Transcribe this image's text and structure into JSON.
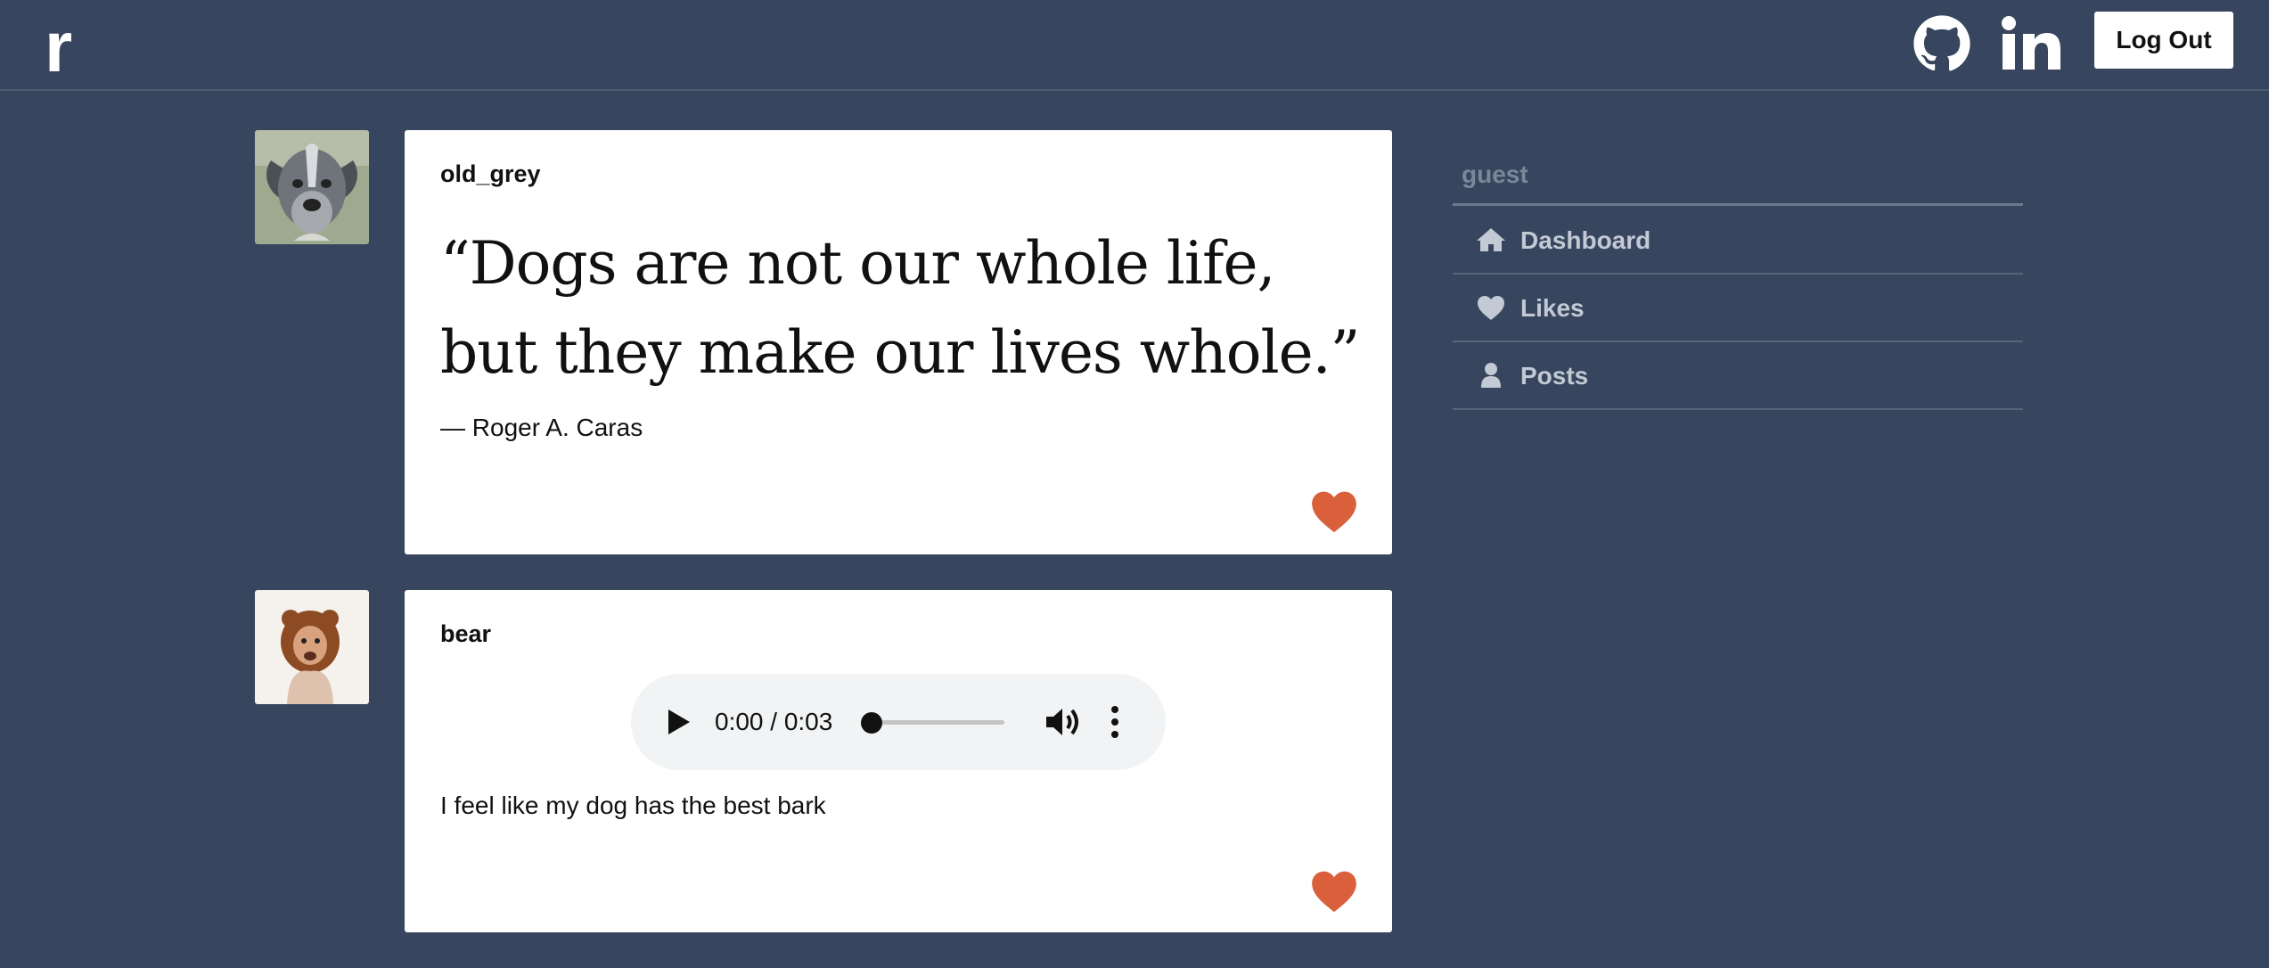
{
  "header": {
    "logo": "r",
    "github_icon": "github-icon",
    "linkedin_icon": "linkedin-icon",
    "logout_label": "Log Out"
  },
  "posts": [
    {
      "username": "old_grey",
      "avatar": "grey-dog-avatar",
      "type": "quote",
      "quote": "“Dogs are not our whole life, but they make our lives whole.”",
      "source": "— Roger A. Caras",
      "like_icon": "heart-icon"
    },
    {
      "username": "bear",
      "avatar": "dog-in-lion-hat-avatar",
      "type": "audio",
      "audio_time": "0:00 / 0:03",
      "audio_progress": 0,
      "text": "I feel like my dog has the best bark",
      "like_icon": "heart-icon"
    }
  ],
  "sidebar": {
    "user": "guest",
    "items": [
      {
        "label": "Dashboard",
        "icon": "home-icon"
      },
      {
        "label": "Likes",
        "icon": "heart-icon"
      },
      {
        "label": "Posts",
        "icon": "user-icon"
      }
    ]
  },
  "colors": {
    "background": "#37465e",
    "card": "#ffffff",
    "like": "#d9603b",
    "sidebar_text": "#c3cad5",
    "sidebar_muted": "#7a8799"
  }
}
